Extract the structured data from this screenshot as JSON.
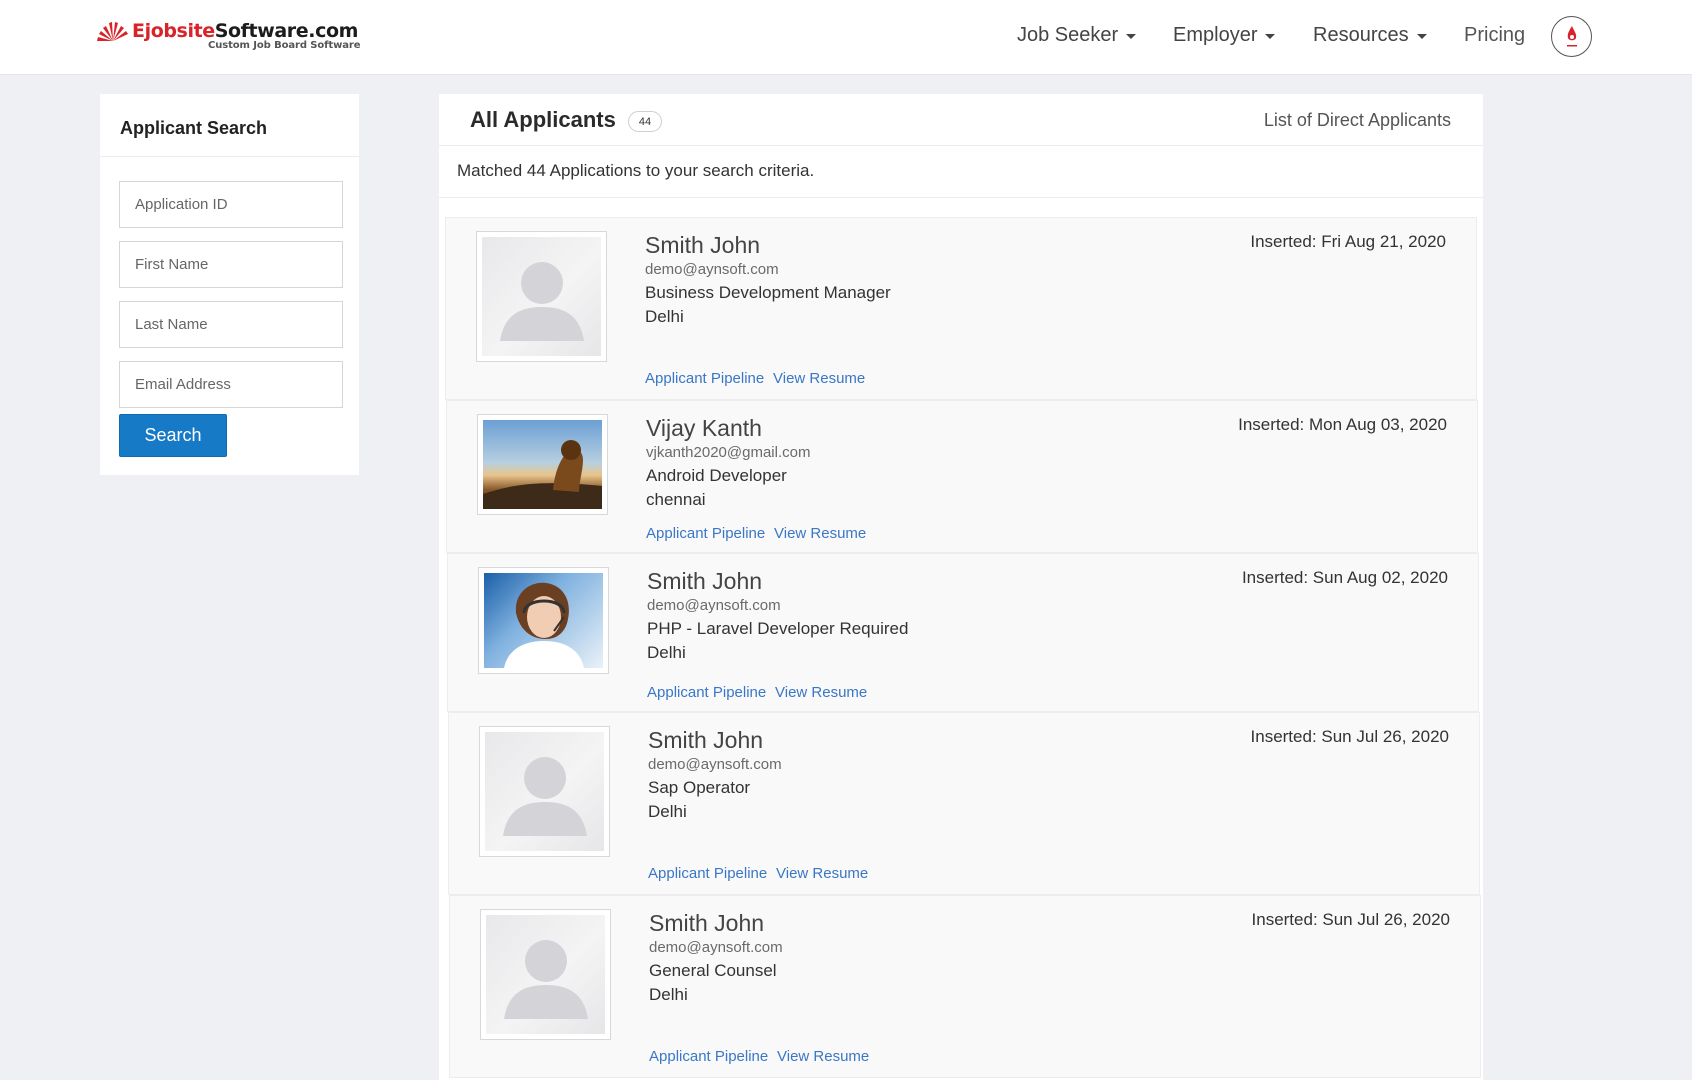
{
  "brand": {
    "name_part1": "Ejobsite",
    "name_part2": "Software.com",
    "tagline": "Custom Job Board Software"
  },
  "nav": {
    "items": [
      {
        "label": "Job Seeker",
        "has_dropdown": true
      },
      {
        "label": "Employer",
        "has_dropdown": true
      },
      {
        "label": "Resources",
        "has_dropdown": true
      },
      {
        "label": "Pricing",
        "has_dropdown": false
      }
    ],
    "user_icon": "user-avatar-icon"
  },
  "sidebar": {
    "title": "Applicant Search",
    "fields": [
      {
        "placeholder": "Application ID",
        "value": ""
      },
      {
        "placeholder": "First Name",
        "value": ""
      },
      {
        "placeholder": "Last Name",
        "value": ""
      },
      {
        "placeholder": "Email Address",
        "value": ""
      }
    ],
    "search_label": "Search"
  },
  "main": {
    "title": "All Applicants",
    "count": "44",
    "subtitle": "List of Direct Applicants",
    "matched_text": "Matched 44 Applications to your search criteria.",
    "link_pipeline": "Applicant Pipeline",
    "link_resume": "View Resume",
    "applicants": [
      {
        "name": "Smith John",
        "email": "demo@aynsoft.com",
        "job": "Business Development Manager",
        "city": "Delhi",
        "inserted": "Inserted: Fri Aug 21, 2020",
        "photo": "generic-avatar"
      },
      {
        "name": "Vijay Kanth",
        "email": "vjkanth2020@gmail.com",
        "job": "Android Developer",
        "city": "chennai",
        "inserted": "Inserted: Mon Aug 03, 2020",
        "photo": "lion-photo"
      },
      {
        "name": "Smith John",
        "email": "demo@aynsoft.com",
        "job": "PHP - Laravel Developer Required",
        "city": "Delhi",
        "inserted": "Inserted: Sun Aug 02, 2020",
        "photo": "woman-headset-photo"
      },
      {
        "name": "Smith John",
        "email": "demo@aynsoft.com",
        "job": "Sap Operator",
        "city": "Delhi",
        "inserted": "Inserted: Sun Jul 26, 2020",
        "photo": "generic-avatar"
      },
      {
        "name": "Smith John",
        "email": "demo@aynsoft.com",
        "job": "General Counsel",
        "city": "Delhi",
        "inserted": "Inserted: Sun Jul 26, 2020",
        "photo": "generic-avatar"
      }
    ]
  }
}
